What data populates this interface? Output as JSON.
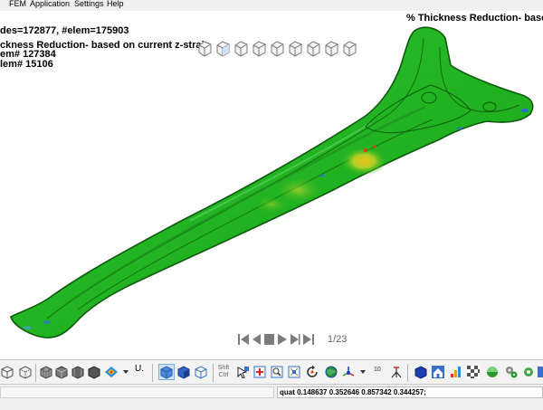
{
  "menu": {
    "items": [
      "FEM",
      "Application",
      "Settings",
      "Help"
    ]
  },
  "viewport": {
    "title_right": "% Thickness Reduction- based",
    "info_lines": [
      "des=172877, #elem=175903",
      "ckness Reduction- based on current z-strain",
      "em# 127384",
      "lem# 15106"
    ]
  },
  "player": {
    "frame_counter": "1/23"
  },
  "toolbar": {
    "shift_ctrl_label": "Shft\nCtrl",
    "u_label": "U.",
    "ten_label": "10"
  },
  "status": {
    "quat_text": "quat 0.148637 0.352646 0.857342 0.344257;"
  },
  "colors": {
    "part_green": "#22b422",
    "part_edge": "#0c5a0c",
    "hot_spot": "#d8c21a",
    "warn_red": "#e23a1a",
    "cool_blue": "#2a6fd8"
  }
}
